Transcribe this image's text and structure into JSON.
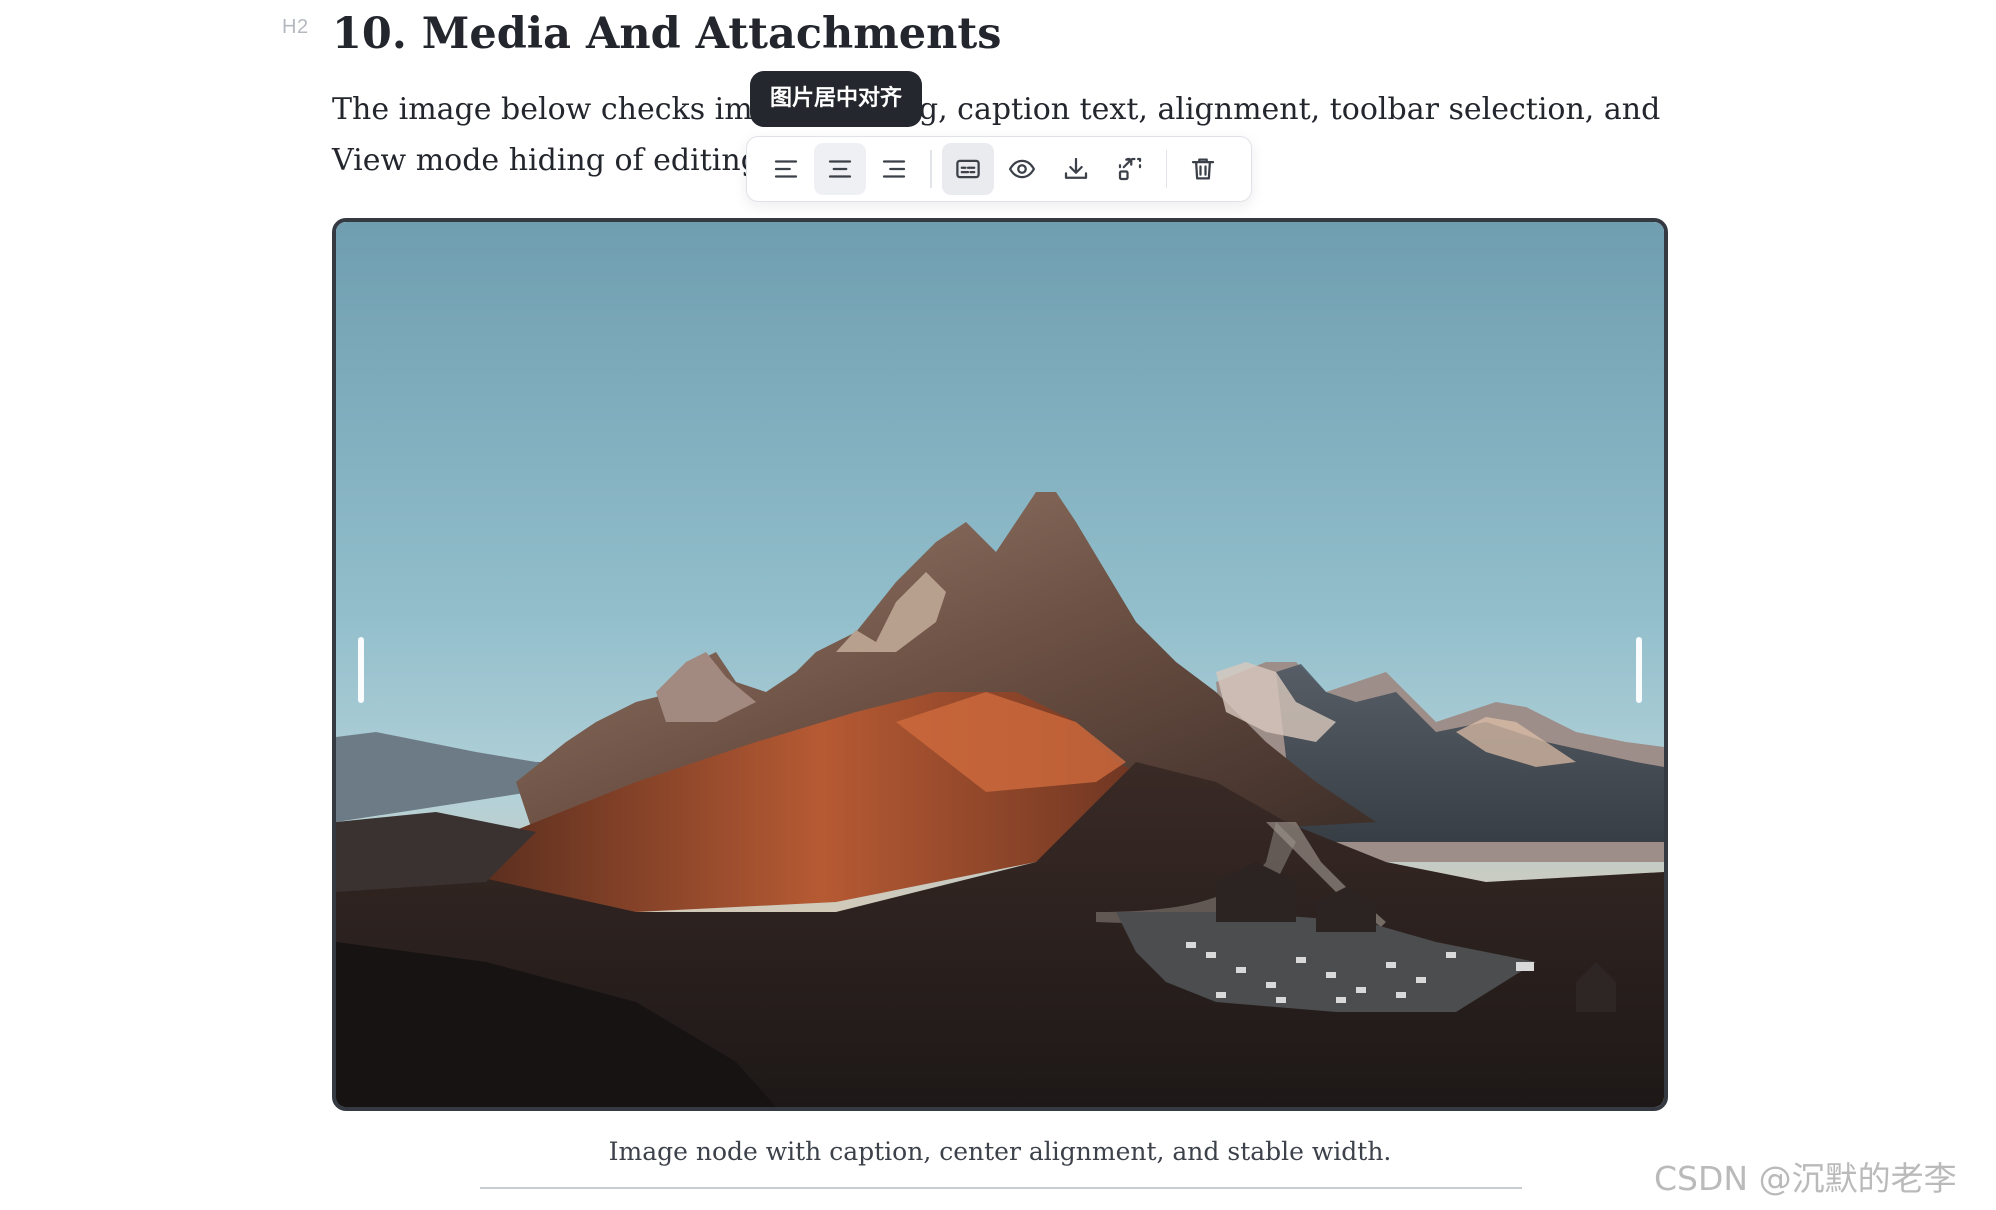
{
  "document": {
    "heading_level": "H2",
    "heading": "10. Media And Attachments",
    "paragraph": "The image below checks image resizing, caption text, alignment, toolbar selection, and View mode hiding of editing handles.",
    "caption": "Image node with caption, center alignment, and stable width."
  },
  "image_toolbar": {
    "tooltip": "图片居中对齐",
    "buttons": [
      {
        "icon": "align-left-icon",
        "state": "normal"
      },
      {
        "icon": "align-center-icon",
        "state": "active"
      },
      {
        "icon": "align-right-icon",
        "state": "normal"
      },
      {
        "icon": "caption-icon",
        "state": "pressed"
      },
      {
        "icon": "eye-icon",
        "state": "normal"
      },
      {
        "icon": "download-icon",
        "state": "normal"
      },
      {
        "icon": "crop-resize-icon",
        "state": "normal"
      },
      {
        "icon": "trash-icon",
        "state": "normal"
      }
    ]
  },
  "image": {
    "subject": "mountain landscape photo",
    "frame_color": "#353a42"
  },
  "watermark": "CSDN @沉默的老李"
}
